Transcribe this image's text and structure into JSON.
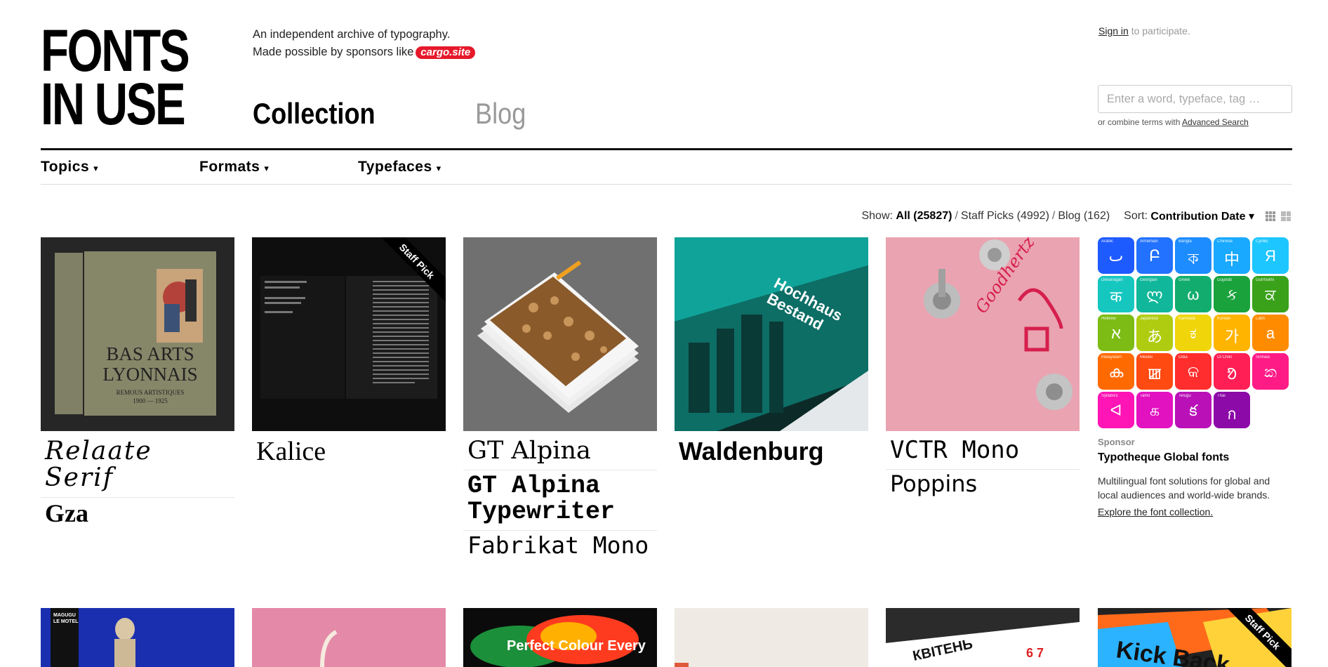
{
  "logo": {
    "line1": "FONTS",
    "line2": "IN USE"
  },
  "tagline": {
    "line1": "An independent archive of typography.",
    "line2": "Made possible by sponsors like",
    "sponsor_badge": "cargo.site"
  },
  "nav": {
    "collection": "Collection",
    "blog": "Blog"
  },
  "account": {
    "sign_in": "Sign in",
    "suffix": " to participate."
  },
  "search": {
    "placeholder": "Enter a word, typeface, tag …",
    "hint_prefix": "or combine terms with ",
    "advanced": "Advanced Search"
  },
  "subnav": {
    "topics": "Topics",
    "formats": "Formats",
    "typefaces": "Typefaces",
    "caret": "▾"
  },
  "filters": {
    "show_label": "Show:",
    "all": "All (25827)",
    "staff": "Staff Picks (4992)",
    "blog": "Blog (162)",
    "sort_label": "Sort:",
    "sort_value": "Contribution Date ▾"
  },
  "cards": [
    {
      "fonts": [
        "Relaate Serif",
        "Gza"
      ],
      "staff_pick": false
    },
    {
      "fonts": [
        "Kalice"
      ],
      "staff_pick": true,
      "staff_label": "Staff Pick"
    },
    {
      "fonts": [
        "GT Alpina",
        "GT Alpina Typewriter",
        "Fabrikat Mono"
      ],
      "staff_pick": false
    },
    {
      "fonts": [
        "Waldenburg"
      ],
      "staff_pick": false
    },
    {
      "fonts": [
        "VCTR Mono",
        "Poppins"
      ],
      "staff_pick": false
    }
  ],
  "sponsor": {
    "label": "Sponsor",
    "name": "Typotheque Global fonts",
    "description": "Multilingual font solutions for global and local audiences and world-wide brands.",
    "link": "Explore the font collection.",
    "scripts": [
      {
        "name": "Arabic",
        "glyph": "ٮ",
        "color": "#1e5bff"
      },
      {
        "name": "Armenian",
        "glyph": "Բ",
        "color": "#2272ff"
      },
      {
        "name": "Bangla",
        "glyph": "ক",
        "color": "#1d8cff"
      },
      {
        "name": "Chinese",
        "glyph": "中",
        "color": "#19a9ff"
      },
      {
        "name": "Cyrillic",
        "glyph": "Я",
        "color": "#1ec6ff"
      },
      {
        "name": "Devanagari",
        "glyph": "क",
        "color": "#16c7c0"
      },
      {
        "name": "Georgian",
        "glyph": "ლ",
        "color": "#10b79a"
      },
      {
        "name": "Greek",
        "glyph": "ω",
        "color": "#12ad6e"
      },
      {
        "name": "Gujarati",
        "glyph": "ક",
        "color": "#1aa33d"
      },
      {
        "name": "Gurmukhi",
        "glyph": "ਕ",
        "color": "#3aa21a"
      },
      {
        "name": "Hebrew",
        "glyph": "א",
        "color": "#7cbc14"
      },
      {
        "name": "Japanese",
        "glyph": "あ",
        "color": "#b0cc10"
      },
      {
        "name": "Kannada",
        "glyph": "ಕ",
        "color": "#f0d50a"
      },
      {
        "name": "Korean",
        "glyph": "가",
        "color": "#ffb400"
      },
      {
        "name": "Latin",
        "glyph": "a",
        "color": "#ff8c00"
      },
      {
        "name": "Malayalam",
        "glyph": "ക",
        "color": "#ff6a00"
      },
      {
        "name": "Meetei",
        "glyph": "ꯀ",
        "color": "#ff4a12"
      },
      {
        "name": "Odia",
        "glyph": "କ",
        "color": "#ff2d2d"
      },
      {
        "name": "Ol Chiki",
        "glyph": "ᱚ",
        "color": "#ff1f55"
      },
      {
        "name": "Sinhala",
        "glyph": "ක",
        "color": "#ff1b86"
      },
      {
        "name": "Syllabics",
        "glyph": "ᐊ",
        "color": "#ff14b5"
      },
      {
        "name": "Tamil",
        "glyph": "க",
        "color": "#e312c0"
      },
      {
        "name": "Telugu",
        "glyph": "క",
        "color": "#b910b8"
      },
      {
        "name": "Thai",
        "glyph": "ก",
        "color": "#8c0aa8"
      }
    ]
  },
  "row2": {
    "thumb3_text": "Perfect Colour Every",
    "thumb5_text": "КВІТЕНЬ",
    "thumb6_text": "Kick Back",
    "thumb1_text": "MAGUGU LE MOTEL",
    "staff_label": "Staff Pick"
  }
}
